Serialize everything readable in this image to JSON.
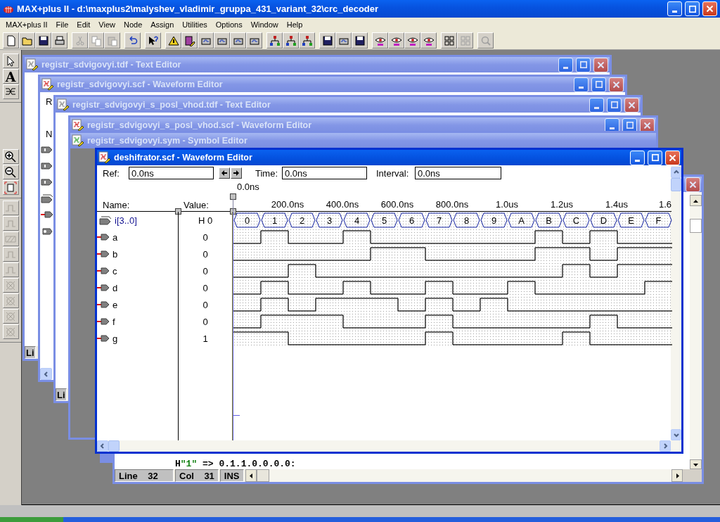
{
  "window": {
    "title": "MAX+plus II - d:\\maxplus2\\malyshev_vladimir_gruppa_431_variant_32\\crc_decoder"
  },
  "menu": [
    "MAX+plus II",
    "File",
    "Edit",
    "View",
    "Node",
    "Assign",
    "Utilities",
    "Options",
    "Window",
    "Help"
  ],
  "toolbar": [
    [
      {
        "kind": "page",
        "disabled": false
      },
      {
        "kind": "folder",
        "disabled": false
      },
      {
        "kind": "disk",
        "disabled": false
      },
      {
        "kind": "printer",
        "disabled": false
      }
    ],
    [
      {
        "kind": "scissors",
        "disabled": true
      },
      {
        "kind": "copy",
        "disabled": true
      },
      {
        "kind": "paste",
        "disabled": true
      }
    ],
    [
      {
        "kind": "undo",
        "disabled": false
      }
    ],
    [
      {
        "kind": "help",
        "disabled": false
      }
    ],
    [
      {
        "kind": "warning",
        "disabled": false
      },
      {
        "kind": "editor",
        "disabled": false
      },
      {
        "kind": "chip",
        "disabled": false
      },
      {
        "kind": "chip",
        "disabled": false
      },
      {
        "kind": "chip",
        "disabled": false
      },
      {
        "kind": "chip",
        "disabled": false
      }
    ],
    [
      {
        "kind": "tree",
        "disabled": false
      },
      {
        "kind": "tree",
        "disabled": false
      },
      {
        "kind": "tree",
        "disabled": false
      }
    ],
    [
      {
        "kind": "disk",
        "disabled": false
      },
      {
        "kind": "chip",
        "disabled": false
      },
      {
        "kind": "disk",
        "disabled": false
      }
    ],
    [
      {
        "kind": "eye",
        "disabled": false
      },
      {
        "kind": "eye",
        "disabled": false
      },
      {
        "kind": "eye",
        "disabled": false
      },
      {
        "kind": "eye",
        "disabled": false
      }
    ],
    [
      {
        "kind": "grid",
        "disabled": false
      },
      {
        "kind": "grid",
        "disabled": true
      }
    ],
    [
      {
        "kind": "magnifier",
        "disabled": true
      }
    ]
  ],
  "palette": [
    [
      {
        "kind": "pointer",
        "disabled": false
      },
      {
        "kind": "text",
        "label": "A",
        "disabled": false
      },
      {
        "kind": "node",
        "disabled": false
      }
    ],
    [
      {
        "kind": "zoom-in",
        "disabled": false
      },
      {
        "kind": "zoom-out",
        "disabled": false
      },
      {
        "kind": "fit",
        "disabled": false
      }
    ],
    [
      {
        "kind": "wave",
        "disabled": true
      },
      {
        "kind": "wave",
        "disabled": true
      },
      {
        "kind": "hatch",
        "disabled": true
      },
      {
        "kind": "wave",
        "disabled": true
      },
      {
        "kind": "wave",
        "disabled": true
      },
      {
        "kind": "gate",
        "disabled": true
      },
      {
        "kind": "gate",
        "disabled": true
      },
      {
        "kind": "gate",
        "disabled": true
      },
      {
        "kind": "gate",
        "disabled": true
      }
    ]
  ],
  "documents": [
    {
      "title": "registr_sdvigovyi.tdf - Text Editor",
      "kind": "text",
      "window_buttons": {
        "minimize": true,
        "maximize": true,
        "close": true
      },
      "status": [
        "Li"
      ]
    },
    {
      "title": "registr_sdvigovyi.scf - Waveform Editor",
      "kind": "waveform",
      "window_buttons": {
        "minimize": true,
        "maximize": true,
        "close": true
      },
      "ref_label": "R",
      "name_label": "N",
      "nodes": [
        {
          "kind": "input"
        },
        {
          "kind": "input"
        },
        {
          "kind": "input"
        },
        {
          "kind": "bus"
        },
        {
          "kind": "output"
        },
        {
          "kind": "other"
        }
      ]
    },
    {
      "title": "registr_sdvigovyi_s_posl_vhod.tdf - Text Editor",
      "kind": "text",
      "window_buttons": {
        "minimize": true,
        "maximize": true,
        "close": true
      },
      "status": [
        "Li"
      ]
    },
    {
      "title": "registr_sdvigovyi_s_posl_vhod.scf - Waveform Editor",
      "kind": "waveform",
      "window_buttons": {
        "minimize": true,
        "maximize": true,
        "close": true
      }
    },
    {
      "title": "registr_sdvigovyi.sym - Symbol Editor",
      "kind": "symbol"
    },
    {
      "kind": "text"
    },
    {
      "kind": "text",
      "window_buttons": {
        "close": true
      },
      "scrollbars": true,
      "lines": [
        [
          {
            "text": "H"
          },
          {
            "text": "\"1\"",
            "kind": "string"
          },
          {
            "text": " => 0.1.1.0.0.0.0:"
          }
        ]
      ],
      "status": [
        "Line    32",
        "Col    31",
        "INS"
      ]
    }
  ],
  "active": {
    "title": "deshifrator.scf - Waveform Editor",
    "window_buttons": {
      "minimize": true,
      "maximize": true,
      "close": true
    },
    "ref_label": "Ref:",
    "ref": "0.0ns",
    "time_label": "Time:",
    "time": "0.0ns",
    "interval_label": "Interval:",
    "interval": "0.0ns",
    "cursor_label": "0.0ns",
    "name_header": "Name:",
    "value_header": "Value:",
    "time_ticks": [
      "200.0ns",
      "400.0ns",
      "600.0ns",
      "800.0ns",
      "1.0us",
      "1.2us",
      "1.4us",
      "1.6"
    ],
    "bus": {
      "name": "i[3..0]",
      "value": "H 0",
      "segments": [
        "0",
        "1",
        "2",
        "3",
        "4",
        "5",
        "6",
        "7",
        "8",
        "9",
        "A",
        "B",
        "C",
        "D",
        "E",
        "F"
      ]
    },
    "signals": [
      {
        "name": "a",
        "value": "0",
        "high": [
          false,
          true,
          false,
          false,
          true,
          false,
          false,
          false,
          false,
          false,
          false,
          true,
          false,
          true,
          false,
          false
        ]
      },
      {
        "name": "b",
        "value": "0",
        "high": [
          false,
          false,
          false,
          false,
          false,
          true,
          true,
          false,
          false,
          false,
          false,
          true,
          true,
          false,
          true,
          true
        ]
      },
      {
        "name": "c",
        "value": "0",
        "high": [
          false,
          false,
          true,
          false,
          false,
          false,
          false,
          false,
          false,
          false,
          false,
          false,
          true,
          false,
          true,
          true
        ]
      },
      {
        "name": "d",
        "value": "0",
        "high": [
          false,
          true,
          false,
          false,
          true,
          false,
          false,
          true,
          false,
          false,
          true,
          false,
          false,
          false,
          false,
          true
        ]
      },
      {
        "name": "e",
        "value": "0",
        "high": [
          false,
          true,
          false,
          true,
          true,
          true,
          false,
          true,
          false,
          true,
          false,
          false,
          false,
          false,
          false,
          false
        ]
      },
      {
        "name": "f",
        "value": "0",
        "high": [
          false,
          true,
          true,
          true,
          false,
          false,
          false,
          true,
          false,
          false,
          false,
          false,
          false,
          true,
          false,
          false
        ]
      },
      {
        "name": "g",
        "value": "1",
        "high": [
          true,
          true,
          false,
          false,
          false,
          false,
          false,
          true,
          false,
          false,
          false,
          false,
          true,
          false,
          false,
          false
        ]
      }
    ]
  }
}
